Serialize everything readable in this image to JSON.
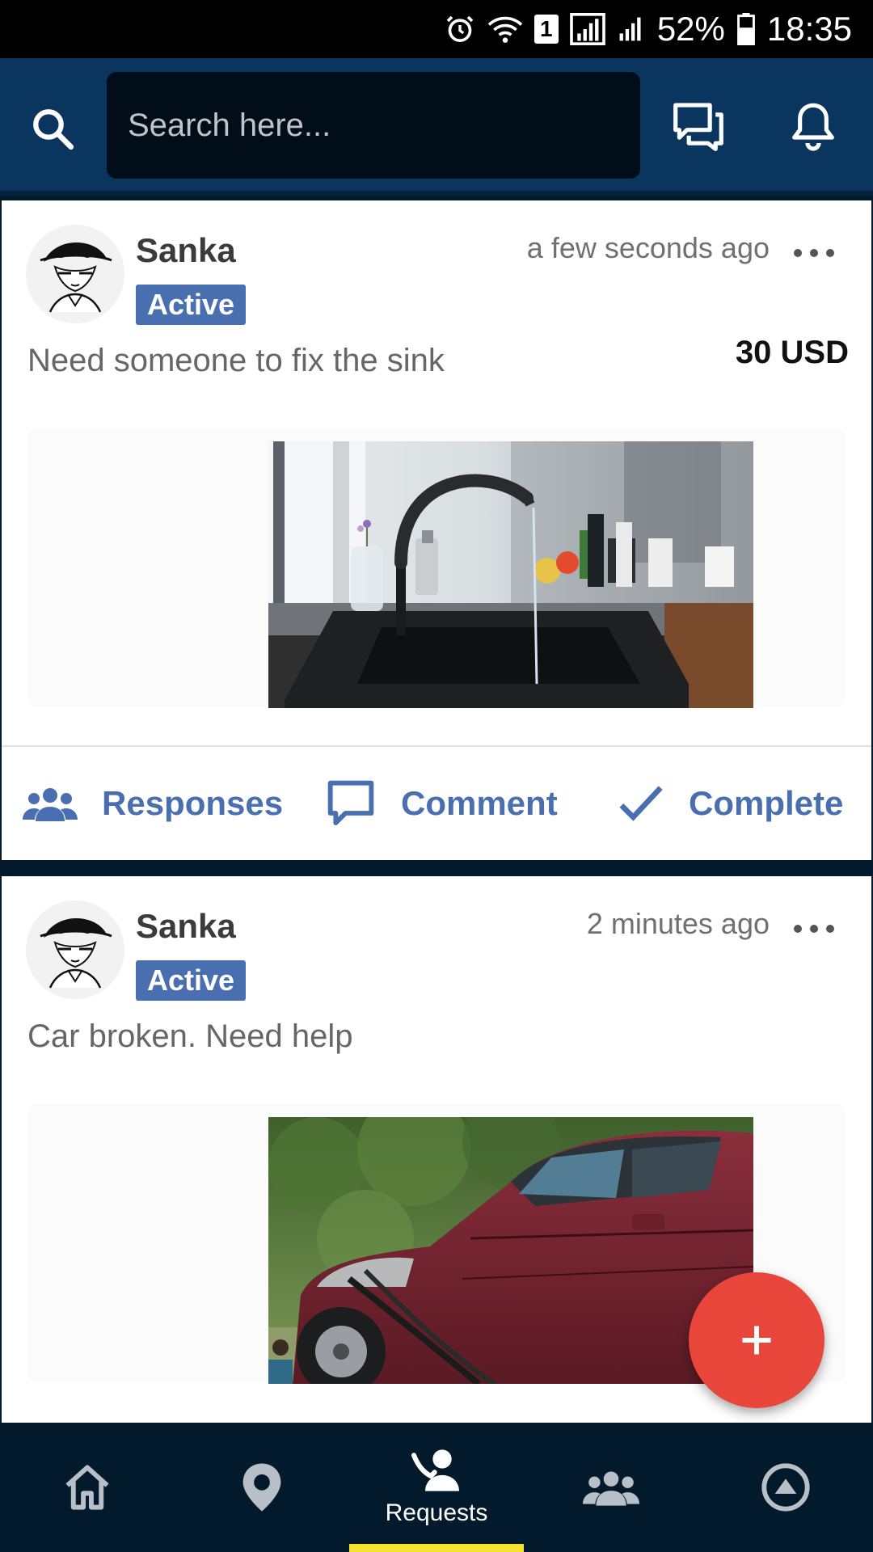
{
  "status_bar": {
    "battery": "52%",
    "time": "18:35",
    "sim_badge": "1"
  },
  "search": {
    "placeholder": "Search here..."
  },
  "posts": [
    {
      "username": "Sanka",
      "status": "Active",
      "time": "a few seconds ago",
      "text": "Need someone to fix the sink",
      "price": "30 USD",
      "image": "kitchen-sink-photo"
    },
    {
      "username": "Sanka",
      "status": "Active",
      "time": "2 minutes ago",
      "text": "Car broken. Need help",
      "price": "",
      "image": "wrecked-car-photo"
    }
  ],
  "actions": {
    "responses": "Responses",
    "comment": "Comment",
    "complete": "Complete"
  },
  "bottom_nav": [
    {
      "icon": "home-icon",
      "label": ""
    },
    {
      "icon": "location-icon",
      "label": ""
    },
    {
      "icon": "requests-icon",
      "label": "Requests",
      "active": true
    },
    {
      "icon": "people-icon",
      "label": ""
    },
    {
      "icon": "navigation-icon",
      "label": ""
    }
  ],
  "colors": {
    "primary": "#0a355f",
    "accent": "#4a6fb0",
    "fab": "#e8463a",
    "nav_indicator": "#f6e32f"
  }
}
